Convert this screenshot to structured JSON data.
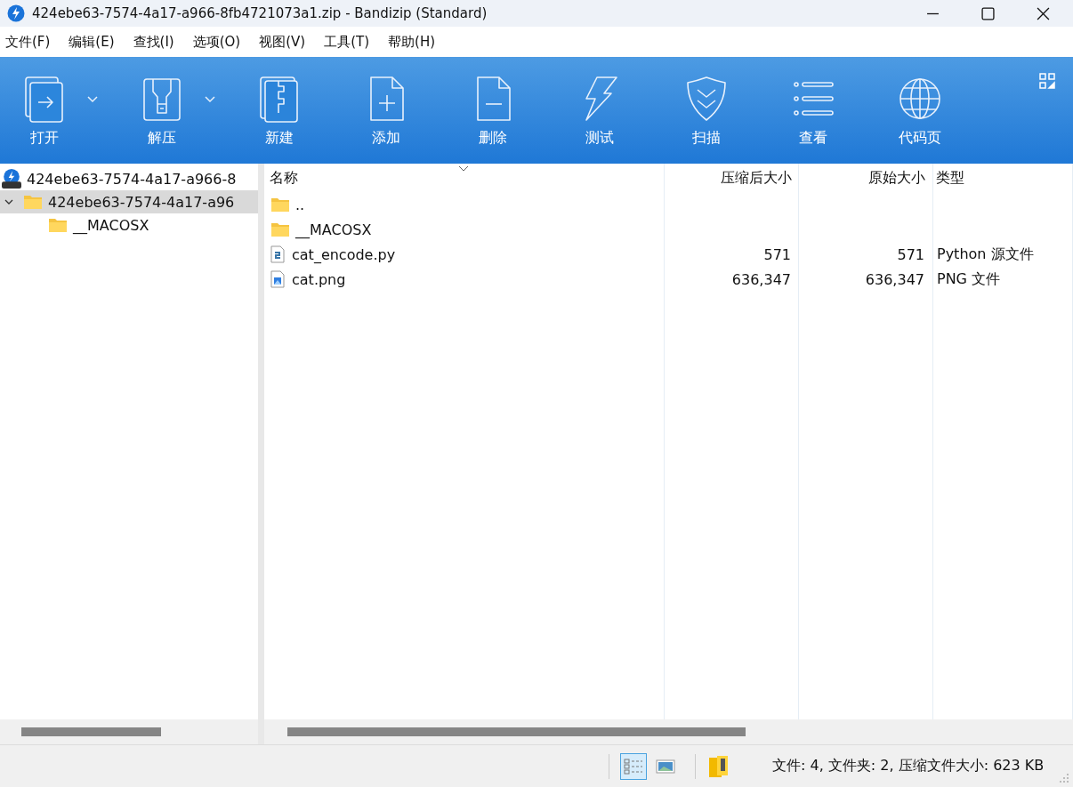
{
  "window": {
    "title": "424ebe63-7574-4a17-a966-8fb4721073a1.zip - Bandizip (Standard)"
  },
  "menu": [
    "文件(F)",
    "编辑(E)",
    "查找(I)",
    "选项(O)",
    "视图(V)",
    "工具(T)",
    "帮助(H)"
  ],
  "toolbar": [
    {
      "label": "打开",
      "has_menu": true
    },
    {
      "label": "解压",
      "has_menu": true
    },
    {
      "label": "新建",
      "has_menu": false
    },
    {
      "label": "添加",
      "has_menu": false
    },
    {
      "label": "删除",
      "has_menu": false
    },
    {
      "label": "测试",
      "has_menu": false
    },
    {
      "label": "扫描",
      "has_menu": false
    },
    {
      "label": "查看",
      "has_menu": false
    },
    {
      "label": "代码页",
      "has_menu": false
    }
  ],
  "tree": [
    {
      "label": "424ebe63-7574-4a17-a966-8",
      "kind": "archive",
      "selected": false,
      "children": [
        {
          "label": "424ebe63-7574-4a17-a96",
          "kind": "folder",
          "selected": true,
          "expanded": true,
          "children": [
            {
              "label": "__MACOSX",
              "kind": "folder",
              "selected": false
            }
          ]
        }
      ]
    }
  ],
  "table": {
    "columns": [
      "名称",
      "压缩后大小",
      "原始大小",
      "类型"
    ],
    "rows": [
      {
        "kind": "folder",
        "name": "..",
        "packed": "",
        "original": "",
        "type": ""
      },
      {
        "kind": "folder",
        "name": "__MACOSX",
        "packed": "",
        "original": "",
        "type": ""
      },
      {
        "kind": "python",
        "name": "cat_encode.py",
        "packed": "571",
        "original": "571",
        "type": "Python 源文件"
      },
      {
        "kind": "image",
        "name": "cat.png",
        "packed": "636,347",
        "original": "636,347",
        "type": "PNG 文件"
      }
    ]
  },
  "status_bar": {
    "views": [
      {
        "kind": "details",
        "selected": true
      },
      {
        "kind": "thumbnails",
        "selected": false
      }
    ],
    "text": "文件: 4, 文件夹: 2, 压缩文件大小: 623 KB"
  }
}
